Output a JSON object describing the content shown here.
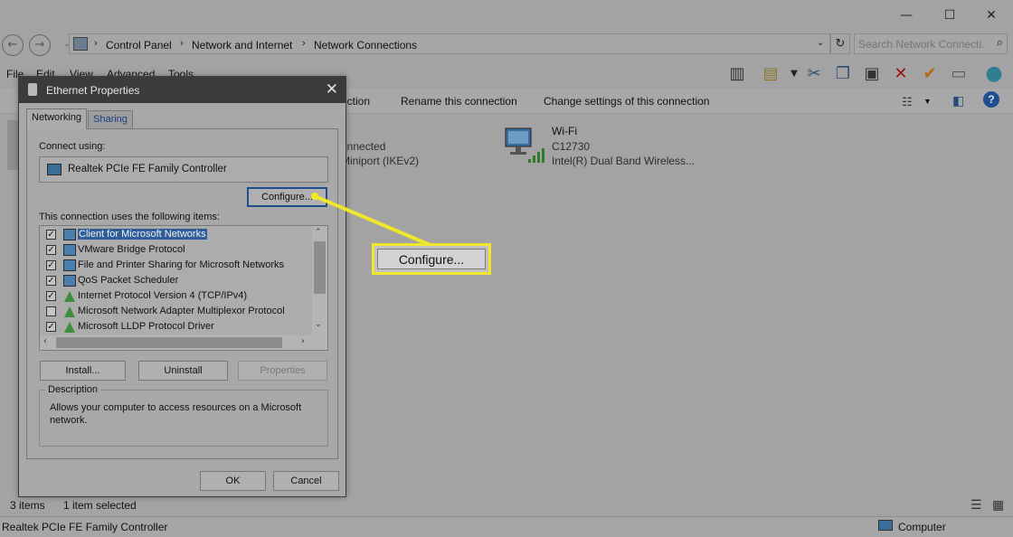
{
  "window": {
    "minimize": "—",
    "maximize": "☐",
    "close": "✕"
  },
  "address": {
    "crumbs": [
      "Control Panel",
      "Network and Internet",
      "Network Connections"
    ],
    "search_placeholder": "Search Network Connecti..."
  },
  "menu": [
    "File",
    "Edit",
    "View",
    "Advanced",
    "Tools"
  ],
  "commands": {
    "partial": "ection",
    "rename": "Rename this connection",
    "change": "Change settings of this connection"
  },
  "connections": [
    {
      "status": "onnected",
      "device": "Miniport (IKEv2)"
    },
    {
      "name": "Wi-Fi",
      "status": "C12730",
      "device": "Intel(R) Dual Band Wireless..."
    }
  ],
  "statusbar": {
    "items": "3 items",
    "selected": "1 item selected"
  },
  "footer": {
    "left": "Realtek PCIe FE Family Controller",
    "right": "Computer"
  },
  "dialog": {
    "title": "Ethernet Properties",
    "tabs": [
      "Networking",
      "Sharing"
    ],
    "connect_using_label": "Connect using:",
    "adapter": "Realtek PCIe FE Family Controller",
    "configure": "Configure...",
    "items_label": "This connection uses the following items:",
    "items": [
      {
        "label": "Client for Microsoft Networks",
        "checked": true,
        "selected": true,
        "icon": "network-component-icon"
      },
      {
        "label": "VMware Bridge Protocol",
        "checked": true,
        "selected": false,
        "icon": "network-component-icon"
      },
      {
        "label": "File and Printer Sharing for Microsoft Networks",
        "checked": true,
        "selected": false,
        "icon": "network-component-icon"
      },
      {
        "label": "QoS Packet Scheduler",
        "checked": true,
        "selected": false,
        "icon": "network-component-icon"
      },
      {
        "label": "Internet Protocol Version 4 (TCP/IPv4)",
        "checked": true,
        "selected": false,
        "icon": "protocol-icon"
      },
      {
        "label": "Microsoft Network Adapter Multiplexor Protocol",
        "checked": false,
        "selected": false,
        "icon": "protocol-icon"
      },
      {
        "label": "Microsoft LLDP Protocol Driver",
        "checked": true,
        "selected": false,
        "icon": "protocol-icon"
      }
    ],
    "install": "Install...",
    "uninstall": "Uninstall",
    "properties": "Properties",
    "description_label": "Description",
    "description": "Allows your computer to access resources on a Microsoft network.",
    "ok": "OK",
    "cancel": "Cancel"
  },
  "callout": {
    "label": "Configure...",
    "color": "#f0e62a"
  }
}
